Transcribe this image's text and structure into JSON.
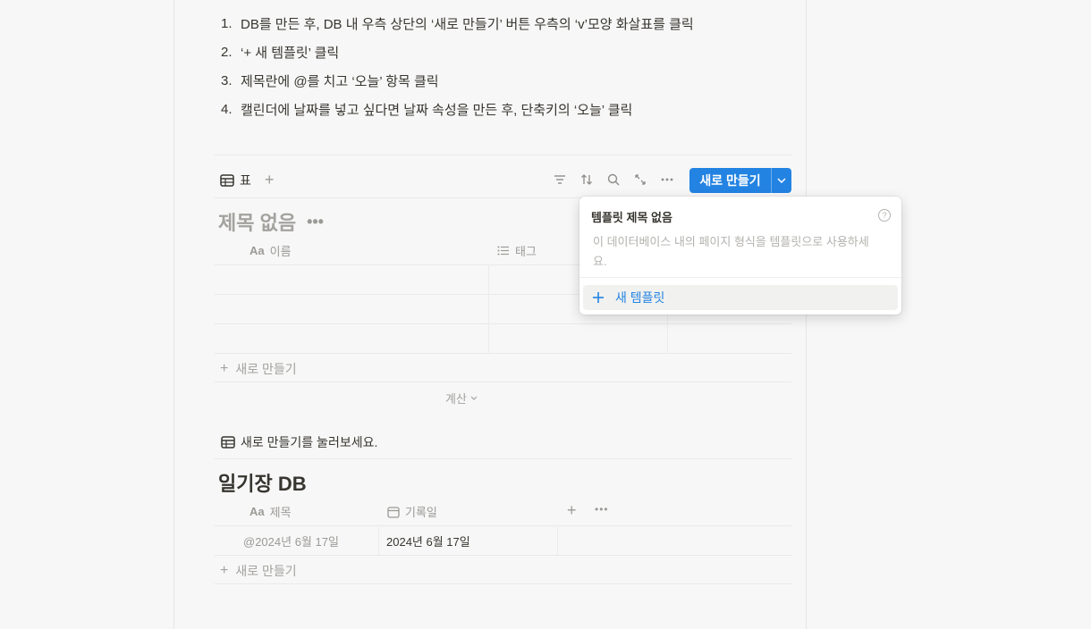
{
  "instructions": {
    "steps": [
      {
        "num": "1.",
        "text": "DB를 만든 후, DB 내 우측 상단의 ‘새로 만들기’ 버튼 우측의 ‘v’모양 화살표를 클릭"
      },
      {
        "num": "2.",
        "text": "‘+ 새 템플릿’ 클릭"
      },
      {
        "num": "3.",
        "text": "제목란에 @를 치고 ‘오늘’ 항목 클릭"
      },
      {
        "num": "4.",
        "text": "캘린더에 날짜를 넣고 싶다면 날짜 속성을 만든 후, 단축키의 ‘오늘’ 클릭"
      }
    ]
  },
  "db1": {
    "view_tab": "표",
    "new_button": "새로 만들기",
    "title": "제목 없음",
    "columns": [
      {
        "icon": "Aa",
        "label": "이름"
      },
      {
        "icon": "list-icon",
        "label": "태그"
      }
    ],
    "add_row": "새로 만들기",
    "calc": "계산"
  },
  "template_popup": {
    "title": "템플릿 제목 없음",
    "description": "이 데이터베이스 내의 페이지 형식을 템플릿으로 사용하세요.",
    "new_template": "새 템플릿"
  },
  "note": "새로 만들기를 눌러보세요.",
  "db2": {
    "title": "일기장 DB",
    "columns": [
      {
        "icon": "Aa",
        "label": "제목"
      },
      {
        "icon": "calendar-icon",
        "label": "기록일"
      }
    ],
    "rows": [
      {
        "title": "@2024년 6월 17일",
        "date": "2024년 6월 17일"
      }
    ],
    "add_row": "새로 만들기"
  },
  "colors": {
    "accent": "#2383e2",
    "text": "#37352f",
    "muted": "#9b9a97",
    "background": "#f7f7f7"
  }
}
